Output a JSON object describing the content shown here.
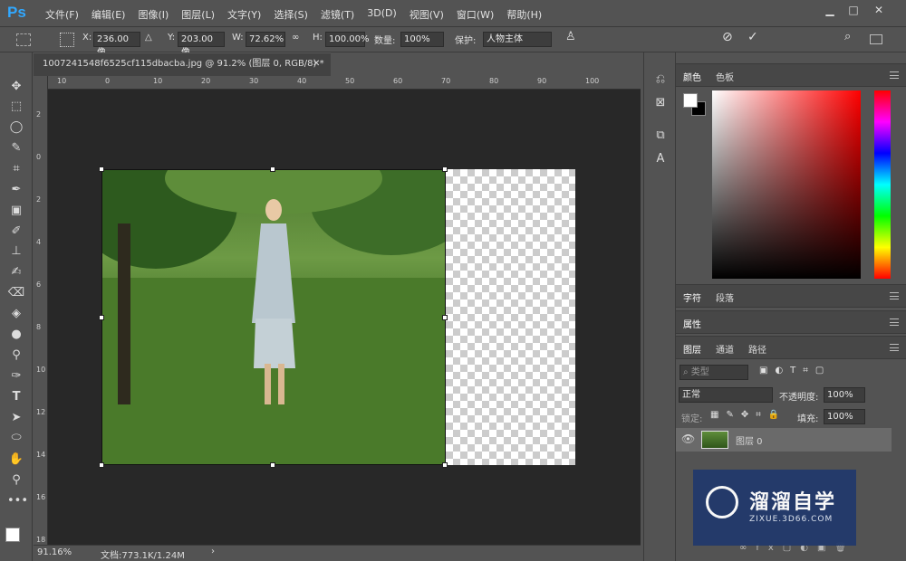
{
  "app": {
    "logo": "Ps"
  },
  "menu": [
    "文件(F)",
    "编辑(E)",
    "图像(I)",
    "图层(L)",
    "文字(Y)",
    "选择(S)",
    "滤镜(T)",
    "3D(D)",
    "视图(V)",
    "窗口(W)",
    "帮助(H)"
  ],
  "options": {
    "x_label": "X:",
    "x_value": "236.00 像",
    "y_label": "Y:",
    "y_value": "203.00 像",
    "w_label": "W:",
    "w_value": "72.62%",
    "h_label": "H:",
    "h_value": "100.00%",
    "amount_label": "数量:",
    "amount_value": "100%",
    "protect_label": "保护:",
    "protect_value": "人物主体"
  },
  "document": {
    "tab_title": "1007241548f6525cf115dbacba.jpg @ 91.2% (图层 0, RGB/8) *",
    "ruler_top": [
      "10",
      "0",
      "10",
      "20",
      "30",
      "40",
      "50",
      "60",
      "70",
      "80",
      "90",
      "100"
    ],
    "ruler_left": [
      "2",
      "0",
      "2",
      "4",
      "6",
      "8",
      "10",
      "12",
      "14",
      "16",
      "18"
    ]
  },
  "status": {
    "zoom": "91.16%",
    "docinfo": "文档:773.1K/1.24M"
  },
  "panels": {
    "color_tabs": [
      "颜色",
      "色板"
    ],
    "char_tabs": [
      "字符",
      "段落"
    ],
    "properties": "属性",
    "layer_tabs": [
      "图层",
      "通道",
      "路径"
    ],
    "kind_placeholder": "类型",
    "blend_mode": "正常",
    "opacity_label": "不透明度:",
    "opacity_value": "100%",
    "lock_label": "锁定:",
    "fill_label": "填充:",
    "fill_value": "100%",
    "layer_name": "图层 0"
  },
  "colors": {
    "accent": "#31a8ff",
    "canvas_bg": "#282828",
    "watermark_bg": "#233a6b"
  },
  "watermark": {
    "title": "溜溜自学",
    "url": "ZIXUE.3D66.COM"
  }
}
